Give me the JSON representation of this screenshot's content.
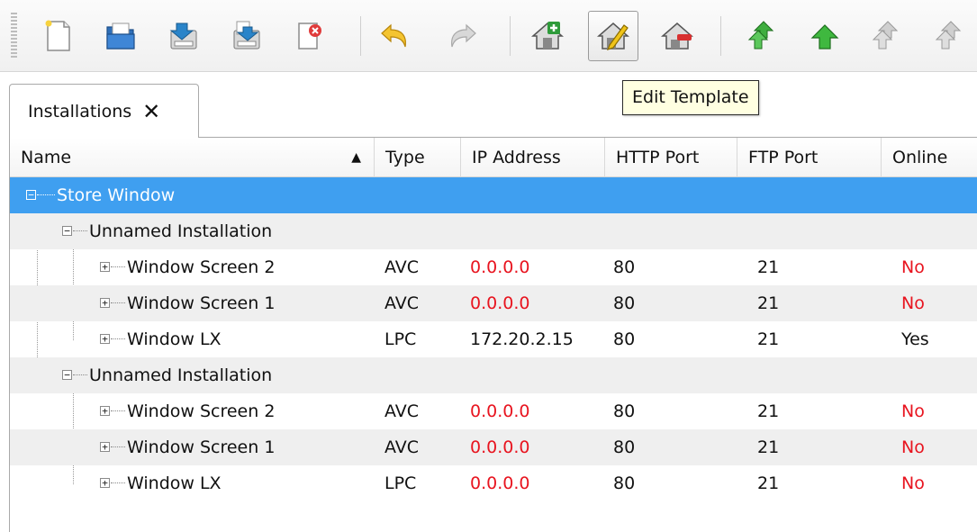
{
  "toolbar": {
    "buttons": [
      {
        "name": "new-document-icon",
        "icon": "new-document"
      },
      {
        "name": "open-folder-icon",
        "icon": "folder-open"
      },
      {
        "name": "save-icon",
        "icon": "save"
      },
      {
        "name": "save-as-icon",
        "icon": "save-as"
      },
      {
        "name": "close-document-icon",
        "icon": "close-document"
      },
      {
        "name": "undo-icon",
        "icon": "undo"
      },
      {
        "name": "redo-icon",
        "icon": "redo"
      },
      {
        "name": "add-template-icon",
        "icon": "house-add"
      },
      {
        "name": "edit-template-icon",
        "icon": "house-edit"
      },
      {
        "name": "remove-template-icon",
        "icon": "house-remove"
      },
      {
        "name": "upload-all-icon",
        "icon": "double-up-arrow"
      },
      {
        "name": "upload-icon",
        "icon": "up-arrow"
      },
      {
        "name": "upload-all-disabled-icon",
        "icon": "double-up-arrow-gray"
      },
      {
        "name": "upload-disabled-icon",
        "icon": "up-arrow-gray"
      }
    ],
    "tooltip": "Edit Template"
  },
  "tabs": [
    {
      "label": "Installations"
    }
  ],
  "table": {
    "columns": {
      "name": "Name",
      "type": "Type",
      "ip": "IP Address",
      "http": "HTTP Port",
      "ftp": "FTP Port",
      "online": "Online"
    },
    "rows": [
      {
        "name": "Store Window",
        "type": "",
        "ip": "",
        "http": "",
        "ftp": "",
        "online": ""
      },
      {
        "name": "Unnamed Installation",
        "type": "",
        "ip": "",
        "http": "",
        "ftp": "",
        "online": ""
      },
      {
        "name": "Window Screen 2",
        "type": "AVC",
        "ip": "0.0.0.0",
        "http": "80",
        "ftp": "21",
        "online": "No"
      },
      {
        "name": "Window Screen 1",
        "type": "AVC",
        "ip": "0.0.0.0",
        "http": "80",
        "ftp": "21",
        "online": "No"
      },
      {
        "name": "Window LX",
        "type": "LPC",
        "ip": "172.20.2.15",
        "http": "80",
        "ftp": "21",
        "online": "Yes"
      },
      {
        "name": "Unnamed Installation",
        "type": "",
        "ip": "",
        "http": "",
        "ftp": "",
        "online": ""
      },
      {
        "name": "Window Screen 2",
        "type": "AVC",
        "ip": "0.0.0.0",
        "http": "80",
        "ftp": "21",
        "online": "No"
      },
      {
        "name": "Window Screen 1",
        "type": "AVC",
        "ip": "0.0.0.0",
        "http": "80",
        "ftp": "21",
        "online": "No"
      },
      {
        "name": "Window LX",
        "type": "LPC",
        "ip": "0.0.0.0",
        "http": "80",
        "ftp": "21",
        "online": "No"
      }
    ]
  },
  "colors": {
    "selection": "#3f9ff0",
    "offline": "#e8141f",
    "tooltip_bg": "#ffffe1"
  }
}
